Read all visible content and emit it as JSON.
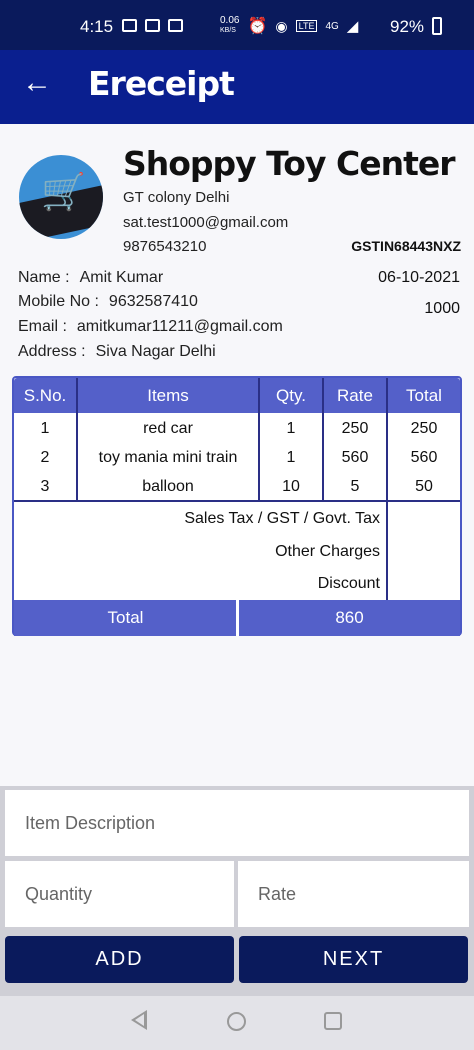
{
  "status_bar": {
    "time": "4:15",
    "net_speed_value": "0.06",
    "net_speed_unit": "KB/S",
    "network": "4G",
    "battery": "92%"
  },
  "app_bar": {
    "title": "Ereceipt"
  },
  "shop": {
    "name": "Shoppy Toy Center",
    "address": "GT colony Delhi",
    "email": "sat.test1000@gmail.com",
    "phone": "9876543210",
    "gstin": "GSTIN68443NXZ"
  },
  "customer": {
    "name_label": "Name :",
    "name": "Amit Kumar",
    "mobile_label": "Mobile No :",
    "mobile": "9632587410",
    "email_label": "Email :",
    "email": "amitkumar11211@gmail.com",
    "address_label": "Address :",
    "address": "Siva Nagar Delhi"
  },
  "bill": {
    "date": "06-10-2021",
    "number": "1000"
  },
  "table": {
    "headers": [
      "S.No.",
      "Items",
      "Qty.",
      "Rate",
      "Total"
    ],
    "rows": [
      [
        "1",
        "red car",
        "1",
        "250",
        "250"
      ],
      [
        "2",
        "toy mania mini train",
        "1",
        "560",
        "560"
      ],
      [
        "3",
        "balloon",
        "10",
        "5",
        "50"
      ]
    ],
    "charges": [
      "Sales Tax / GST / Govt. Tax",
      "Other Charges",
      "Discount"
    ],
    "total_label": "Total",
    "total_value": "860"
  },
  "form": {
    "item_placeholder": "Item Description",
    "quantity_placeholder": "Quantity",
    "rate_placeholder": "Rate",
    "add_label": "ADD",
    "next_label": "NEXT"
  },
  "icons": {
    "back": "arrow-left-icon",
    "logo": "shopping-cart-logo",
    "nav": [
      "nav-back-icon",
      "nav-home-icon",
      "nav-recent-icon"
    ]
  },
  "colors": {
    "primary": "#0a1f8f",
    "status_bar": "#0a1a5c",
    "table_header": "#5460c9",
    "button": "#0a1a5c"
  }
}
